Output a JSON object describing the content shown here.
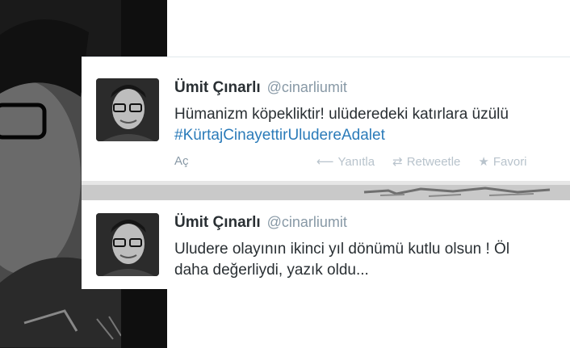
{
  "tweets": [
    {
      "name": "Ümit Çınarlı",
      "handle": "@cinarliumit",
      "text": "Hümanizm köpekliktir! ulüderedeki katırlara üzülü",
      "hashtag": "#KürtajCinayettirUludereAdalet",
      "expand": "Aç",
      "actions": {
        "reply": "Yanıtla",
        "retweet": "Retweetle",
        "favorite": "Favori"
      }
    },
    {
      "name": "Ümit Çınarlı",
      "handle": "@cinarliumit",
      "text_line1": "Uludere olayının ikinci yıl dönümü kutlu olsun ! Öl",
      "text_line2": "daha değerliydi, yazık oldu..."
    }
  ],
  "icons": {
    "reply": "reply-arrow-icon",
    "retweet": "retweet-icon",
    "favorite": "star-icon"
  },
  "colors": {
    "hashtag": "#2b7bb9",
    "name": "#292f33",
    "muted": "#8899a6"
  }
}
